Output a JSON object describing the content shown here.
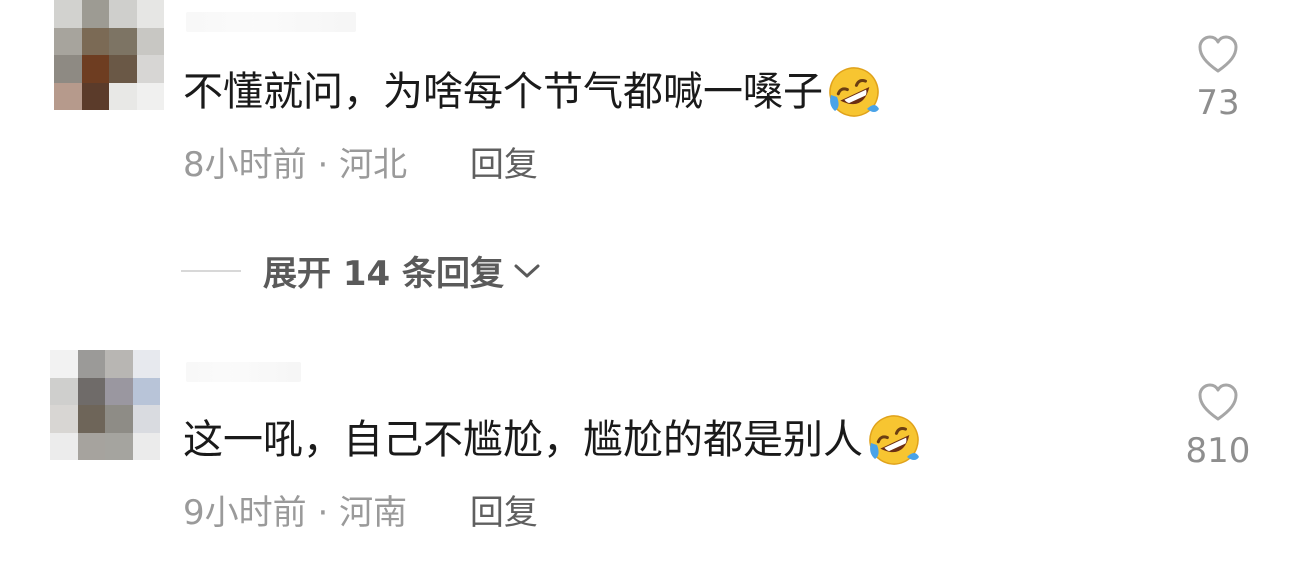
{
  "comments": [
    {
      "text": "不懂就问，为啥每个节气都喊一嗓子",
      "time": "8小时前",
      "location": "河北",
      "reply_label": "回复",
      "likes": "73",
      "emoji": "rolling-on-floor-laughing-emoji"
    },
    {
      "text": "这一吼，自己不尴尬，尴尬的都是别人",
      "time": "9小时前",
      "location": "河南",
      "reply_label": "回复",
      "likes": "810",
      "emoji": "rolling-on-floor-laughing-emoji"
    }
  ],
  "expand_replies": {
    "label": "展开 14 条回复"
  },
  "meta_separator": " · ",
  "colors": {
    "text": "#1a1a1a",
    "meta": "#9a9a9a",
    "reply": "#5f5f5f",
    "like": "#8e8e8e",
    "emoji_face": "#f7c531",
    "emoji_tear": "#4aa3e8"
  }
}
